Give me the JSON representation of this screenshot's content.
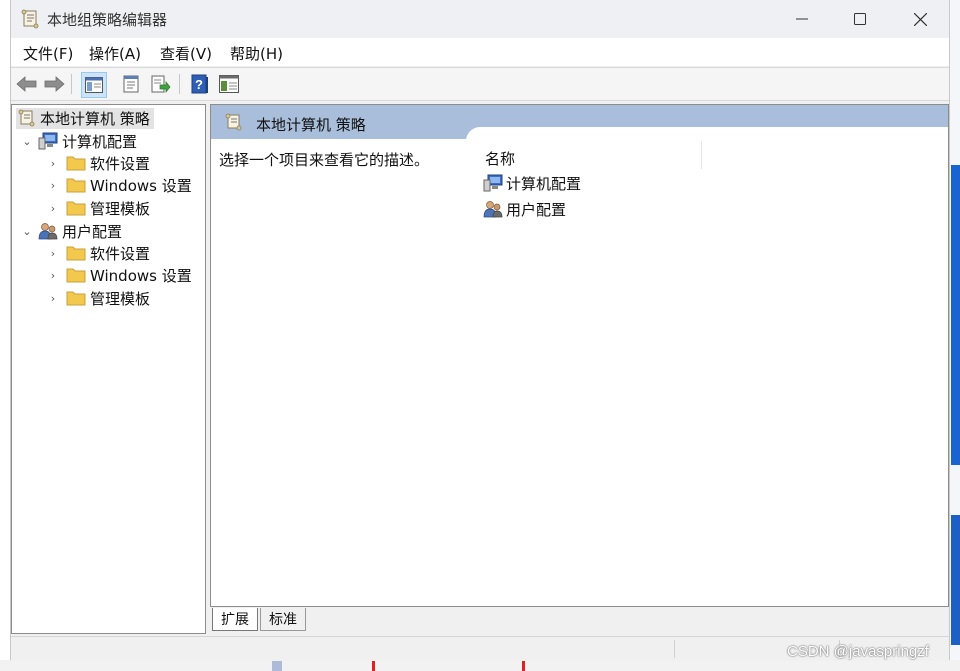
{
  "window": {
    "title": "本地组策略编辑器",
    "controls": {
      "minimize": "—",
      "maximize": "☐",
      "close": "✕"
    }
  },
  "menu": [
    {
      "label": "文件(F)"
    },
    {
      "label": "操作(A)"
    },
    {
      "label": "查看(V)"
    },
    {
      "label": "帮助(H)"
    }
  ],
  "toolbar": {
    "icons": [
      "back-arrow-icon",
      "forward-arrow-icon",
      "show-hide-tree-icon",
      "properties-icon",
      "export-list-icon",
      "help-icon",
      "extended-view-icon"
    ]
  },
  "tree": {
    "root": "本地计算机 策略",
    "nodes": [
      {
        "label": "计算机配置",
        "children": [
          "软件设置",
          "Windows 设置",
          "管理模板"
        ]
      },
      {
        "label": "用户配置",
        "children": [
          "软件设置",
          "Windows 设置",
          "管理模板"
        ]
      }
    ]
  },
  "details": {
    "header": "本地计算机 策略",
    "description": "选择一个项目来查看它的描述。",
    "column_name": "名称",
    "items": [
      "计算机配置",
      "用户配置"
    ]
  },
  "tabs": [
    {
      "label": "扩展",
      "active": true
    },
    {
      "label": "标准",
      "active": false
    }
  ],
  "watermark": "CSDN @javaspringzf",
  "colors": {
    "header_band": "#a9bedb",
    "folder": "#f2c94c",
    "window_bg": "#f0f0f0"
  }
}
